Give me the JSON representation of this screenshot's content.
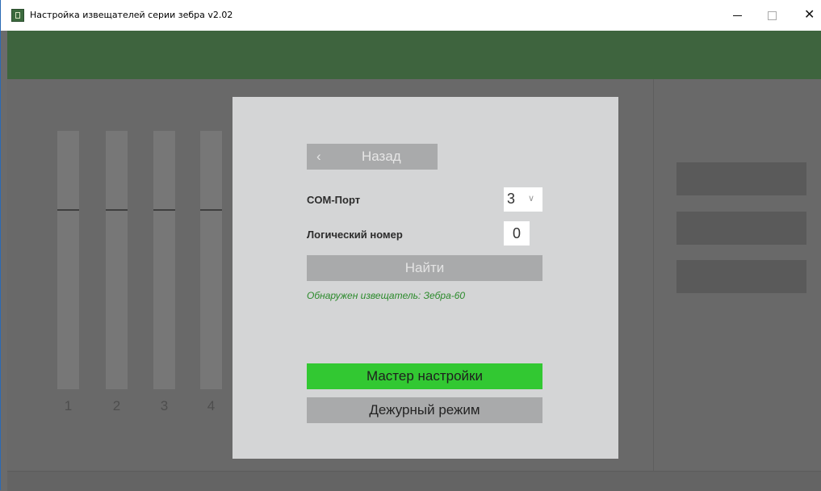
{
  "window": {
    "title": "Настройка извещателей серии зебра v2.02",
    "minimize_label": "–",
    "close_label": "✕"
  },
  "channels": [
    "1",
    "2",
    "3",
    "4"
  ],
  "dialog": {
    "back_label": "Назад",
    "com_port_label": "COM-Порт",
    "com_port_value": "3",
    "logical_number_label": "Логический номер",
    "logical_number_value": "0",
    "find_label": "Найти",
    "status": "Обнаружен извещатель: Зебра-60",
    "wizard_label": "Мастер настройки",
    "duty_label": "Дежурный режим"
  },
  "colors": {
    "header": "#3e643e",
    "accent_green": "#32c832",
    "status_green": "#2b8a2b",
    "dialog_bg": "#d4d5d6"
  }
}
